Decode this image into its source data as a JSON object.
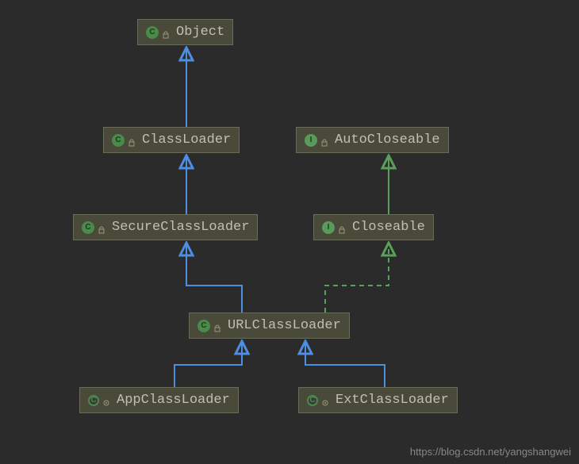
{
  "diagram": {
    "nodes": {
      "object": "Object",
      "classLoader": "ClassLoader",
      "autoCloseable": "AutoCloseable",
      "secureClassLoader": "SecureClassLoader",
      "closeable": "Closeable",
      "urlClassLoader": "URLClassLoader",
      "appClassLoader": "AppClassLoader",
      "extClassLoader": "ExtClassLoader"
    },
    "iconGlyphs": {
      "class": "C",
      "interface": "I"
    },
    "colors": {
      "extendsArrow": "#4d8ee0",
      "implementsArrow": "#5aa05a",
      "nodeBg": "#4a4a3a",
      "nodeBorder": "#6b6b5b",
      "text": "#c0c0b0",
      "background": "#2b2b2b"
    }
  },
  "watermark": "https://blog.csdn.net/yangshangwei",
  "chart_data": {
    "type": "class-hierarchy-diagram",
    "nodes": [
      {
        "id": "Object",
        "kind": "class"
      },
      {
        "id": "ClassLoader",
        "kind": "class"
      },
      {
        "id": "AutoCloseable",
        "kind": "interface"
      },
      {
        "id": "SecureClassLoader",
        "kind": "class"
      },
      {
        "id": "Closeable",
        "kind": "interface"
      },
      {
        "id": "URLClassLoader",
        "kind": "class"
      },
      {
        "id": "AppClassLoader",
        "kind": "class"
      },
      {
        "id": "ExtClassLoader",
        "kind": "class"
      }
    ],
    "edges": [
      {
        "from": "ClassLoader",
        "to": "Object",
        "relation": "extends"
      },
      {
        "from": "SecureClassLoader",
        "to": "ClassLoader",
        "relation": "extends"
      },
      {
        "from": "URLClassLoader",
        "to": "SecureClassLoader",
        "relation": "extends"
      },
      {
        "from": "AppClassLoader",
        "to": "URLClassLoader",
        "relation": "extends"
      },
      {
        "from": "ExtClassLoader",
        "to": "URLClassLoader",
        "relation": "extends"
      },
      {
        "from": "Closeable",
        "to": "AutoCloseable",
        "relation": "extends-interface"
      },
      {
        "from": "URLClassLoader",
        "to": "Closeable",
        "relation": "implements"
      }
    ]
  }
}
